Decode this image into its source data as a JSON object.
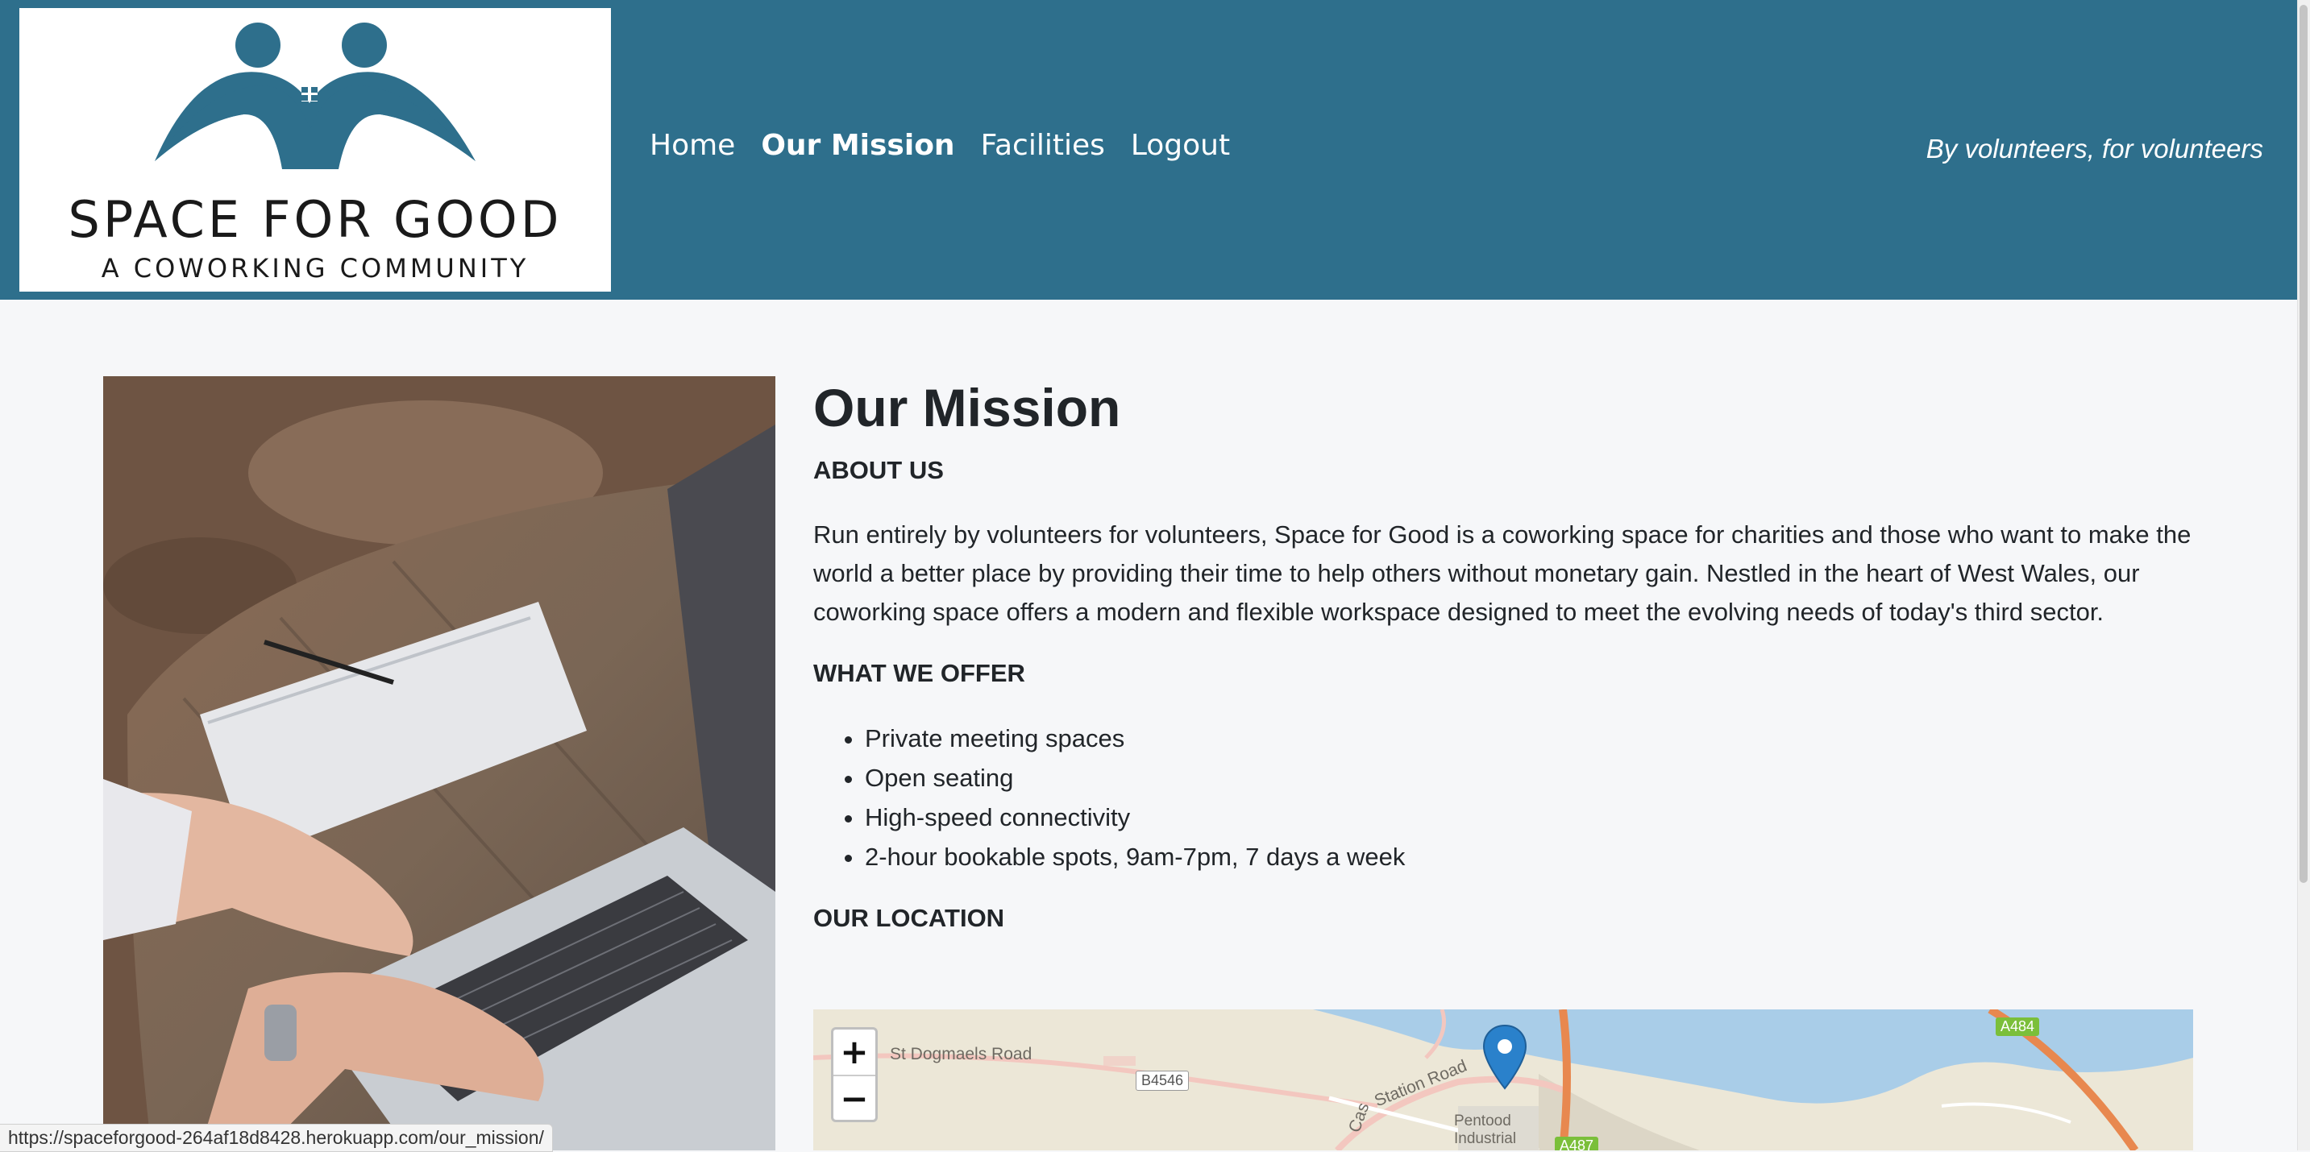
{
  "brand": {
    "logo_title": "SPACE FOR GOOD",
    "logo_subtitle": "A COWORKING COMMUNITY",
    "header_color": "#2e6f8c",
    "logo_color": "#2e6f8c"
  },
  "nav": {
    "items": [
      {
        "label": "Home",
        "active": false
      },
      {
        "label": "Our Mission",
        "active": true
      },
      {
        "label": "Facilities",
        "active": false
      },
      {
        "label": "Logout",
        "active": false
      }
    ]
  },
  "tagline": "By volunteers, for volunteers",
  "page": {
    "title": "Our Mission",
    "about_heading": "ABOUT US",
    "about_text": "Run entirely by volunteers for volunteers, Space for Good is a coworking space for charities and those who want to make the world a better place by providing their time to help others without monetary gain. Nestled in the heart of West Wales, our coworking space offers a modern and flexible workspace designed to meet the evolving needs of today's third sector.",
    "offer_heading": "WHAT WE OFFER",
    "offers": [
      "Private meeting spaces",
      "Open seating",
      "High-speed connectivity",
      "2-hour bookable spots, 9am-7pm, 7 days a week"
    ],
    "location_heading": "OUR LOCATION"
  },
  "map": {
    "zoom_in_label": "+",
    "zoom_out_label": "−",
    "labels": {
      "st_dogmaels_road": "St Dogmaels Road",
      "station_road": "Station Road",
      "pentood_industrial_1": "Pentood",
      "pentood_industrial_2": "Industrial",
      "castle": "Cas"
    },
    "roads": {
      "b4546": "B4546",
      "a484": "A484",
      "a487": "A487"
    },
    "water_color": "#a9cde8",
    "land_color": "#ece7d7",
    "marker_color": "#2a81cb"
  },
  "status_bar": {
    "url": "https://spaceforgood-264af18d8428.herokuapp.com/our_mission/"
  }
}
